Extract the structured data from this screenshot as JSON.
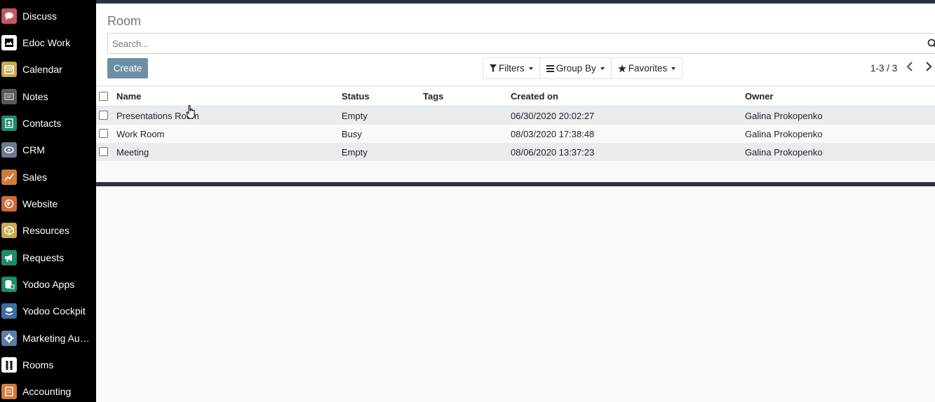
{
  "sidebar": {
    "items": [
      {
        "label": "Discuss",
        "icon": "chat-icon",
        "color": "#c5565f"
      },
      {
        "label": "Edoc Work",
        "icon": "document-icon",
        "color": "#ffffff"
      },
      {
        "label": "Calendar",
        "icon": "calendar-icon",
        "color": "#c9a94e"
      },
      {
        "label": "Notes",
        "icon": "notes-icon",
        "color": "#5a5a5a"
      },
      {
        "label": "Contacts",
        "icon": "address-book-icon",
        "color": "#1e8a6e"
      },
      {
        "label": "CRM",
        "icon": "handshake-icon",
        "color": "#6c7a8c"
      },
      {
        "label": "Sales",
        "icon": "chart-line-icon",
        "color": "#d07b3c"
      },
      {
        "label": "Website",
        "icon": "globe-icon",
        "color": "#d2693a"
      },
      {
        "label": "Resources",
        "icon": "cube-icon",
        "color": "#c9a94e"
      },
      {
        "label": "Requests",
        "icon": "megaphone-icon",
        "color": "#1e8a6e"
      },
      {
        "label": "Yodoo Apps",
        "icon": "database-icon",
        "color": "#1e8a6e"
      },
      {
        "label": "Yodoo Cockpit",
        "icon": "cloud-hand-icon",
        "color": "#3a6ea5"
      },
      {
        "label": "Marketing Aut...",
        "icon": "gear-icon",
        "color": "#5a7fa8"
      },
      {
        "label": "Rooms",
        "icon": "people-icon",
        "color": "#ffffff"
      },
      {
        "label": "Accounting",
        "icon": "invoice-icon",
        "color": "#d07b3c"
      }
    ]
  },
  "breadcrumb": "Room",
  "search": {
    "placeholder": "Search..."
  },
  "toolbar": {
    "create_label": "Create",
    "filters_label": "Filters",
    "groupby_label": "Group By",
    "favorites_label": "Favorites"
  },
  "pager": {
    "text": "1-3 / 3"
  },
  "table": {
    "columns": [
      "Name",
      "Status",
      "Tags",
      "Created on",
      "Owner"
    ],
    "rows": [
      {
        "name": "Presentations Room",
        "status": "Empty",
        "tags": "",
        "created_on": "06/30/2020 20:02:27",
        "owner": "Galina Prokopenko"
      },
      {
        "name": "Work Room",
        "status": "Busy",
        "tags": "",
        "created_on": "08/03/2020 17:38:48",
        "owner": "Galina Prokopenko"
      },
      {
        "name": "Meeting",
        "status": "Empty",
        "tags": "",
        "created_on": "08/06/2020 13:37:23",
        "owner": "Galina Prokopenko"
      }
    ]
  },
  "colors": {
    "accent": "#6c8ea6",
    "topbar": "#263340",
    "sidebar_bg": "#000000"
  }
}
